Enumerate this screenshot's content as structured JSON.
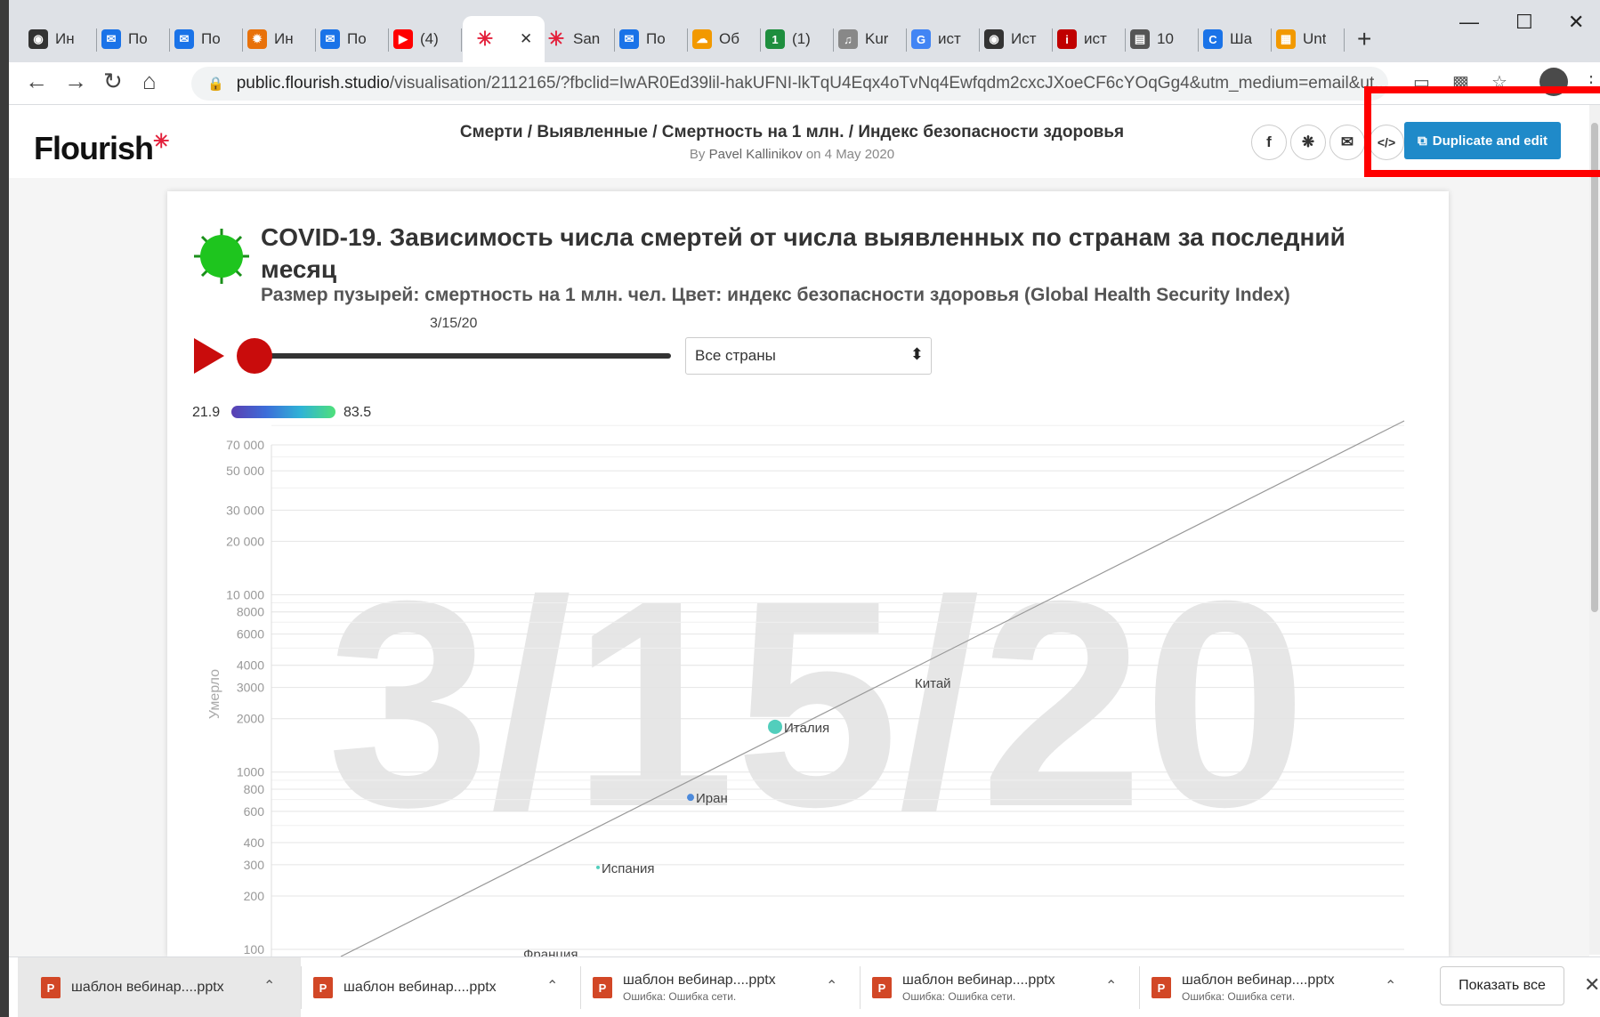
{
  "browser": {
    "tabs": [
      {
        "label": "Ин",
        "icon": "globe-icon",
        "color": "#333333"
      },
      {
        "label": "По",
        "icon": "mail-icon",
        "color": "#1a73e8"
      },
      {
        "label": "По",
        "icon": "mail-icon",
        "color": "#1a73e8"
      },
      {
        "label": "Ин",
        "icon": "chrome-icon",
        "color": "#e8710a"
      },
      {
        "label": "По",
        "icon": "mail-icon",
        "color": "#1a73e8"
      },
      {
        "label": "(4)",
        "icon": "youtube-icon",
        "color": "#ff0000"
      },
      {
        "label": "",
        "icon": "flourish-icon",
        "color": "#e3203b",
        "active": true
      },
      {
        "label": "San",
        "icon": "flourish-icon",
        "color": "#e3203b"
      },
      {
        "label": "По",
        "icon": "mail-icon",
        "color": "#1a73e8"
      },
      {
        "label": "Об",
        "icon": "cloud-icon",
        "color": "#f29900"
      },
      {
        "label": "(1)",
        "icon": "app-icon",
        "color": "#1e8e3e"
      },
      {
        "label": "Kur",
        "icon": "kurs-icon",
        "color": "#888888"
      },
      {
        "label": "ист",
        "icon": "google-icon",
        "color": "#4285f4"
      },
      {
        "label": "Ист",
        "icon": "github-icon",
        "color": "#333333"
      },
      {
        "label": "ист",
        "icon": "info-icon",
        "color": "#c00000"
      },
      {
        "label": "10",
        "icon": "site-icon",
        "color": "#555555"
      },
      {
        "label": "Ша",
        "icon": "canva-icon",
        "color": "#1a73e8"
      },
      {
        "label": "Unt",
        "icon": "untitled-icon",
        "color": "#f29900"
      }
    ],
    "new_tab": "+",
    "url_host": "public.flourish.studio",
    "url_path": "/visualisation/2112165/?fbclid=IwAR0Ed39lil-hakUFNI-lkTqU4Eqx4oTvNq4Ewfqdm2cxcJXoeCF6cYOqGg4&utm_medium=email&ut..."
  },
  "flourish": {
    "logo": "Flourish",
    "title": "Смерти / Выявленные / Смертность на 1 млн. / Индекс безопасности здоровья",
    "byline_prefix": "By",
    "author": "Pavel Kallinikov",
    "byline_date": "on 4 May 2020",
    "duplicate_label": "Duplicate and edit",
    "embed_label": "</>"
  },
  "chart_header": {
    "title": "COVID-19. Зависимость числа смертей от числа выявленных по странам за последний месяц",
    "subtitle": "Размер пузырей: смертность на 1 млн. чел. Цвет: индекс безопасности здоровья (Global Health Security Index)",
    "slider_date": "3/15/20",
    "filter_value": "Все страны",
    "legend_min": "21.9",
    "legend_max": "83.5"
  },
  "chart_data": {
    "type": "scatter",
    "watermark": "3/15/20",
    "ylabel": "Умерло",
    "y_scale": "log",
    "ylim": [
      100,
      70000
    ],
    "yticks": [
      {
        "v": 70000,
        "label": "70 000"
      },
      {
        "v": 50000,
        "label": "50 000"
      },
      {
        "v": 30000,
        "label": "30 000"
      },
      {
        "v": 20000,
        "label": "20 000"
      },
      {
        "v": 10000,
        "label": "10 000"
      },
      {
        "v": 8000,
        "label": "8000"
      },
      {
        "v": 6000,
        "label": "6000"
      },
      {
        "v": 4000,
        "label": "4000"
      },
      {
        "v": 3000,
        "label": "3000"
      },
      {
        "v": 2000,
        "label": "2000"
      },
      {
        "v": 1000,
        "label": "1000"
      },
      {
        "v": 800,
        "label": "800"
      },
      {
        "v": 600,
        "label": "600"
      },
      {
        "v": 400,
        "label": "400"
      },
      {
        "v": 300,
        "label": "300"
      },
      {
        "v": 200,
        "label": "200"
      },
      {
        "v": 100,
        "label": "100"
      }
    ],
    "minor_gridlines": [
      90000,
      60000,
      40000,
      9000,
      7000,
      5000,
      900,
      700,
      500
    ],
    "points": [
      {
        "name": "Китай",
        "y": 3200,
        "color": "#3ad38a",
        "bubble": 0
      },
      {
        "name": "Италия",
        "y": 1800,
        "color": "#3fc9b5",
        "bubble": 8
      },
      {
        "name": "Иран",
        "y": 720,
        "color": "#3b7fd9",
        "bubble": 4
      },
      {
        "name": "Испания",
        "y": 290,
        "color": "#3fc9b5",
        "bubble": 2
      },
      {
        "name": "Франция",
        "y": 95,
        "color": "#3fc9b5",
        "bubble": 0
      }
    ],
    "reference_line": true
  },
  "downloads": {
    "items": [
      {
        "name": "шаблон вебинар....pptx",
        "status": ""
      },
      {
        "name": "шаблон вебинар....pptx",
        "status": ""
      },
      {
        "name": "шаблон вебинар....pptx",
        "status": "Ошибка: Ошибка сети."
      },
      {
        "name": "шаблон вебинар....pptx",
        "status": "Ошибка: Ошибка сети."
      },
      {
        "name": "шаблон вебинар....pptx",
        "status": "Ошибка: Ошибка сети."
      }
    ],
    "show_all": "Показать все"
  }
}
